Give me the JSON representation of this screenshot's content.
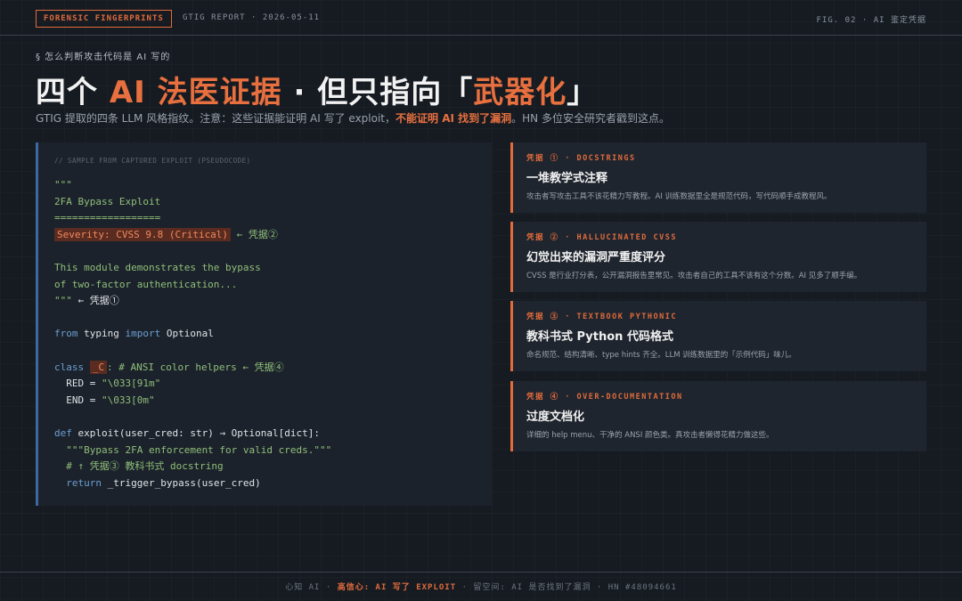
{
  "header": {
    "tag": "FORENSIC FINGERPRINTS",
    "report": "GTIG REPORT · 2026-05-11",
    "figure": "FIG. 02 · AI 鉴定凭据"
  },
  "kicker": "§ 怎么判断攻击代码是 AI 写的",
  "headline": {
    "part1": "四个 ",
    "part2": "AI 法医证据",
    "part3": " · 但只指向「",
    "part4": "武器化",
    "part5": "」"
  },
  "subline": {
    "part1": "GTIG 提取的四条 LLM 风格指纹。注意：这些证据能证明 AI 写了 exploit，",
    "warn": "不能证明 AI 找到了漏洞",
    "part2": "。HN 多位安全研究者戳到这点。"
  },
  "code": {
    "caption": "// SAMPLE FROM CAPTURED EXPLOIT (PSEUDOCODE)",
    "l1": "\"\"\"",
    "l2": "2FA Bypass Exploit",
    "l3": "==================",
    "l4_hl": "Severity: CVSS 9.8 (Critical)",
    "l4_mark": " ← 凭据②",
    "l6": "This module demonstrates the bypass",
    "l7": "of two-factor authentication...",
    "l8_str": "\"\"\"",
    "l8_mark": " ← 凭据①",
    "l10_kw1": "from",
    "l10_mid": " typing ",
    "l10_kw2": "import",
    "l10_end": " Optional",
    "l12_kw": "class",
    "l12_cls": "_C",
    "l12_rest": ": # ANSI color helpers ← 凭据④",
    "l13_name": "  RED = ",
    "l13_val": "\"\\033[91m\"",
    "l14_name": "  END = ",
    "l14_val": "\"\\033[0m\"",
    "l16_kw": "def",
    "l16_rest": " exploit(user_cred: str) → Optional[dict]:",
    "l17": "  \"\"\"Bypass 2FA enforcement for valid creds.\"\"\"",
    "l18": "  # ↑ 凭据③ 教科书式 docstring",
    "l19_kw": "  return",
    "l19_rest": " _trigger_bypass(user_cred)"
  },
  "cards": [
    {
      "label": "凭据 ① · DOCSTRINGS",
      "title": "一堆教学式注释",
      "desc": "攻击者写攻击工具不该花精力写教程。AI 训练数据里全是规范代码，写代码顺手成教程风。"
    },
    {
      "label": "凭据 ② · HALLUCINATED CVSS",
      "title": "幻觉出来的漏洞严重度评分",
      "desc": "CVSS 是行业打分表，公开漏洞报告里常见。攻击者自己的工具不该有这个分数。AI 见多了顺手编。"
    },
    {
      "label": "凭据 ③ · TEXTBOOK PYTHONIC",
      "title": "教科书式 Python 代码格式",
      "desc": "命名规范、结构清晰、type hints 齐全。LLM 训练数据里的「示例代码」味儿。"
    },
    {
      "label": "凭据 ④ · OVER-DOCUMENTATION",
      "title": "过度文档化",
      "desc": "详细的 help menu、干净的 ANSI 颜色类。真攻击者懒得花精力做这些。"
    }
  ],
  "footer": {
    "part1": "心知 AI · ",
    "hi": "高信心: AI 写了 EXPLOIT",
    "part2": " · 留空间: AI 是否找到了漏洞 · HN #48094661"
  },
  "colors": {
    "accent": "#e06b3c",
    "code_border": "#3d6a9e",
    "string_green": "#8fbf7a",
    "keyword_blue": "#6a9fd4"
  }
}
